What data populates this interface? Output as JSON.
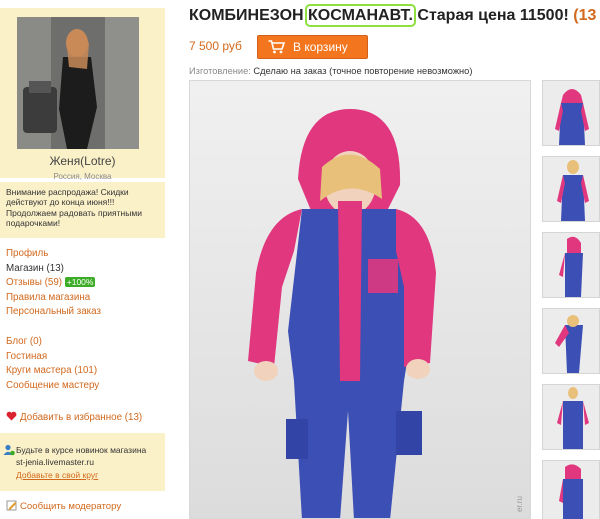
{
  "seller": {
    "name": "Женя(Lotre)",
    "location": "Россия, Москва"
  },
  "notice": "Внимание распродажа! Скидки действуют до конца июня!!! Продолжаем радовать приятными подарочками!",
  "shop_menu": {
    "profile": "Профиль",
    "shop": "Магазин (13)",
    "reviews": "Отзывы (59)",
    "reviews_badge": "+100%",
    "rules": "Правила магазина",
    "custom_order": "Персональный заказ"
  },
  "social_menu": {
    "blog": "Блог (0)",
    "guestbook": "Гостиная",
    "circles": "Круги мастера (101)",
    "message": "Сообщение мастеру"
  },
  "favorites": "Добавить в избранное (13)",
  "subscribe": {
    "text_line1": "Будьте в курсе новинок магазина",
    "text_line2": "st-jenia.livemaster.ru",
    "link": "Добавьте в свой круг"
  },
  "report": "Сообщить модератору",
  "product": {
    "title_part1": "КОМБИНЕЗОН ",
    "title_highlight": "КОСМАНАВТ.",
    "title_part2": " Старая цена 11500! ",
    "title_tail": "(13",
    "price": "7 500 руб",
    "cart_button": "В корзину",
    "made_label": "Изготовление:",
    "made_value": "Сделаю на заказ",
    "made_note": "(точное повторение невозможно)",
    "watermark": "er.ru"
  },
  "colors": {
    "accent": "#d2691e",
    "cart": "#f3761f",
    "panel": "#fbf1c9",
    "suit_pink": "#e0377f",
    "suit_blue": "#3b4fb5",
    "highlight": "#8ee03f",
    "badge": "#3cab26"
  },
  "icons": [
    "heart-icon",
    "cart-icon",
    "subscribe-icon",
    "pencil-icon"
  ]
}
